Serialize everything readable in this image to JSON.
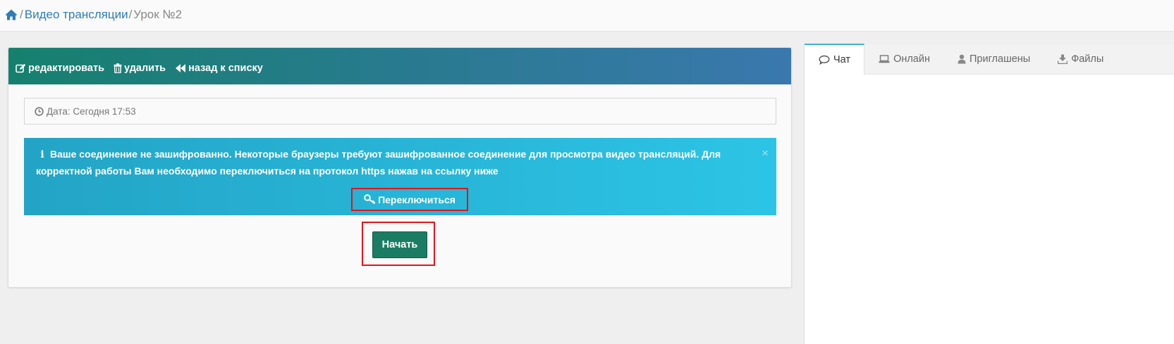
{
  "breadcrumb": {
    "items": [
      "Видео трансляции"
    ],
    "current": "Урок №2",
    "separator": "/"
  },
  "toolbar": {
    "edit_label": "редактировать",
    "delete_label": "удалить",
    "back_label": "назад к списку"
  },
  "date": {
    "label": "Дата: Сегодня 17:53"
  },
  "alert": {
    "text": "Ваше соединение не зашифрованно. Некоторые браузеры требуют зашифрованное соединение для просмотра видео трансляций. Для корректной работы Вам необходимо переключиться на протокол https нажав на ссылку ниже",
    "close": "×",
    "switch_label": "Переключиться"
  },
  "start_label": "Начать",
  "side_tabs": [
    "Чат",
    "Онлайн",
    "Приглашены",
    "Файлы"
  ],
  "colors": {
    "header_gradient_start": "#16806e",
    "header_gradient_end": "#3a78ad",
    "alert_bg": "#2cc4e6",
    "start_button": "#1a7d63",
    "highlight": "#e3141b",
    "link": "#2e7cb8"
  },
  "icons": {
    "home": "home-icon",
    "edit": "edit-icon",
    "delete": "trash-icon",
    "back": "double-chevron-left-icon",
    "date": "clock-icon",
    "info": "info-icon",
    "switch": "key-icon",
    "chat": "comment-icon",
    "online": "laptop-icon",
    "invited": "user-icon",
    "files": "download-icon"
  }
}
